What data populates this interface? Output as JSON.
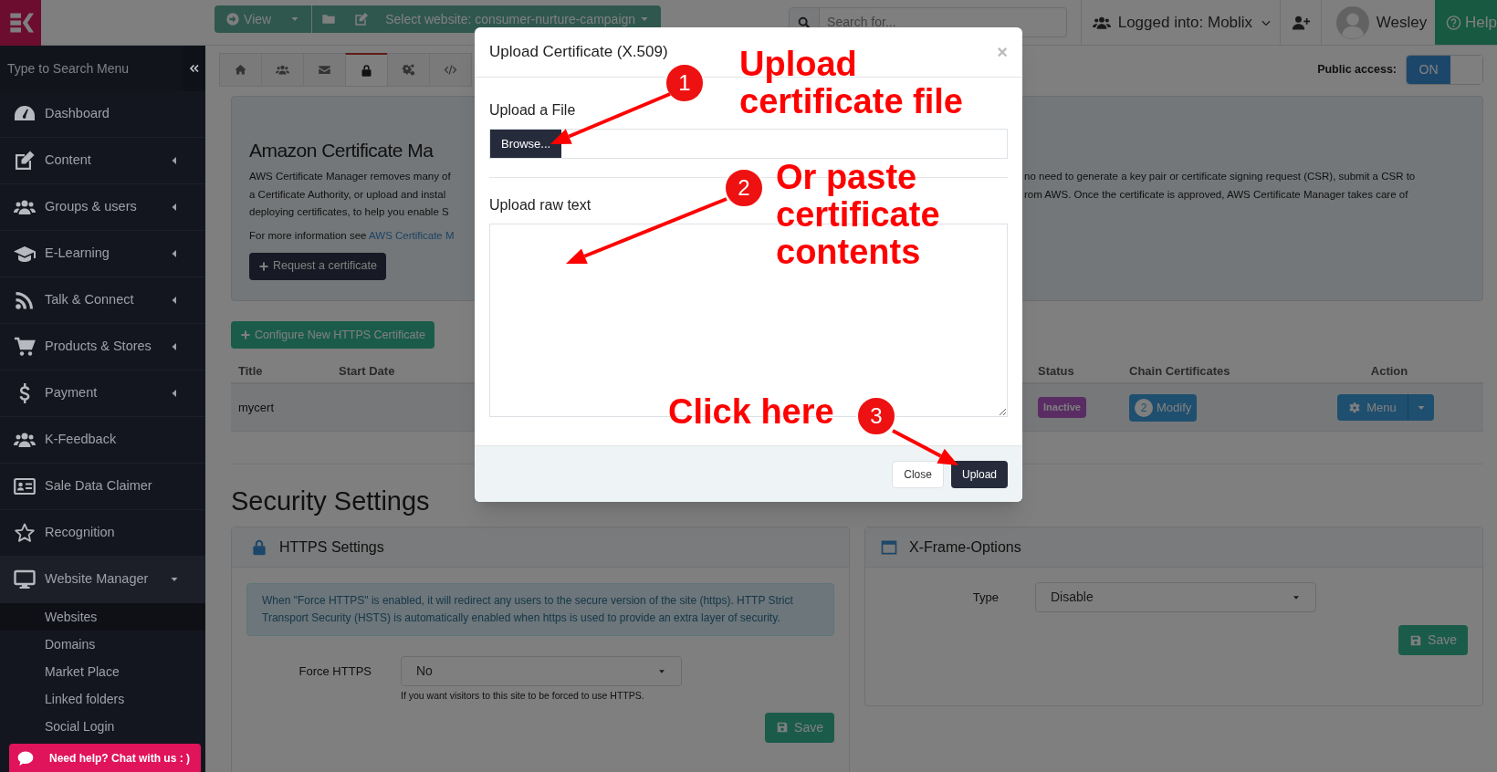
{
  "topbar": {
    "view_button": "View",
    "website_select": "Select website: consumer-nurture-campaign",
    "search": {
      "placeholder": "Search for..."
    },
    "logged_into": "Logged into: Moblix",
    "user": "Wesley",
    "help": "Help"
  },
  "sidebar": {
    "search": {
      "placeholder": "Type to Search Menu"
    },
    "items": [
      {
        "label": "Dashboard"
      },
      {
        "label": "Content",
        "expanded": false
      },
      {
        "label": "Groups & users",
        "expanded": false
      },
      {
        "label": "E-Learning",
        "expanded": false
      },
      {
        "label": "Talk & Connect",
        "expanded": false
      },
      {
        "label": "Products & Stores",
        "expanded": false
      },
      {
        "label": "Payment",
        "expanded": false
      },
      {
        "label": "K-Feedback"
      },
      {
        "label": "Sale Data Claimer"
      },
      {
        "label": "Recognition"
      },
      {
        "label": "Website Manager",
        "expanded": true,
        "children": [
          {
            "label": "Websites",
            "selected": true
          },
          {
            "label": "Domains",
            "selected": false
          },
          {
            "label": "Market Place",
            "selected": false
          },
          {
            "label": "Linked folders",
            "selected": false
          },
          {
            "label": "Social Login",
            "selected": false
          }
        ]
      }
    ]
  },
  "tabs": [
    {
      "selected": false
    },
    {
      "selected": false
    },
    {
      "selected": false
    },
    {
      "selected": true
    },
    {
      "selected": false
    },
    {
      "selected": false
    }
  ],
  "public_access": {
    "label": "Public access:",
    "on": true,
    "state_text": "ON"
  },
  "acm": {
    "title": "Amazon Certificate Ma",
    "lines": [
      {
        "start": "AWS Certificate Manager removes many of",
        "end": "no need to generate a key pair or certificate signing request (CSR), submit a CSR to"
      },
      {
        "start": "a Certificate Authority, or upload and instal",
        "end": "rom AWS. Once the certificate is approved, AWS Certificate Manager takes care of"
      },
      {
        "start": "deploying certificates, to help you enable S"
      }
    ],
    "more_info": "For more information see",
    "more_info_link": "AWS Certificate M",
    "request_button": "Request a certificate"
  },
  "configure_button": "Configure New HTTPS Certificate",
  "table": {
    "columns": [
      "Title",
      "Start Date",
      "Status",
      "Chain Certificates",
      "Action"
    ],
    "rows": [
      {
        "title": "mycert",
        "status": "Inactive",
        "chain_count": "2",
        "chain_button": "Modify",
        "action": "Menu"
      }
    ]
  },
  "security": {
    "title": "Security Settings",
    "https": {
      "title": "HTTPS Settings",
      "info": "When \"Force HTTPS\" is enabled, it will redirect any users to the secure version of the site (https). HTTP Strict Transport Security (HSTS) is automatically enabled when https is used to provide an extra layer of security.",
      "field_label": "Force HTTPS",
      "value": "No",
      "help": "If you want visitors to this site to be forced to use HTTPS.",
      "save": "Save"
    },
    "xframe": {
      "title": "X-Frame-Options",
      "field_label": "Type",
      "value": "Disable",
      "save": "Save"
    }
  },
  "modal": {
    "title": "Upload Certificate (X.509)",
    "close": "×",
    "file_label": "Upload a File",
    "browse": "Browse...",
    "raw_label": "Upload raw text",
    "buttons": [
      "Close",
      "Upload"
    ]
  },
  "annotations": [
    {
      "number": "1",
      "text": "Upload certificate file"
    },
    {
      "number": "2",
      "text": "Or paste certificate contents"
    },
    {
      "number": "3",
      "text": "Click here"
    }
  ],
  "chat": "Need help? Chat with us : )"
}
